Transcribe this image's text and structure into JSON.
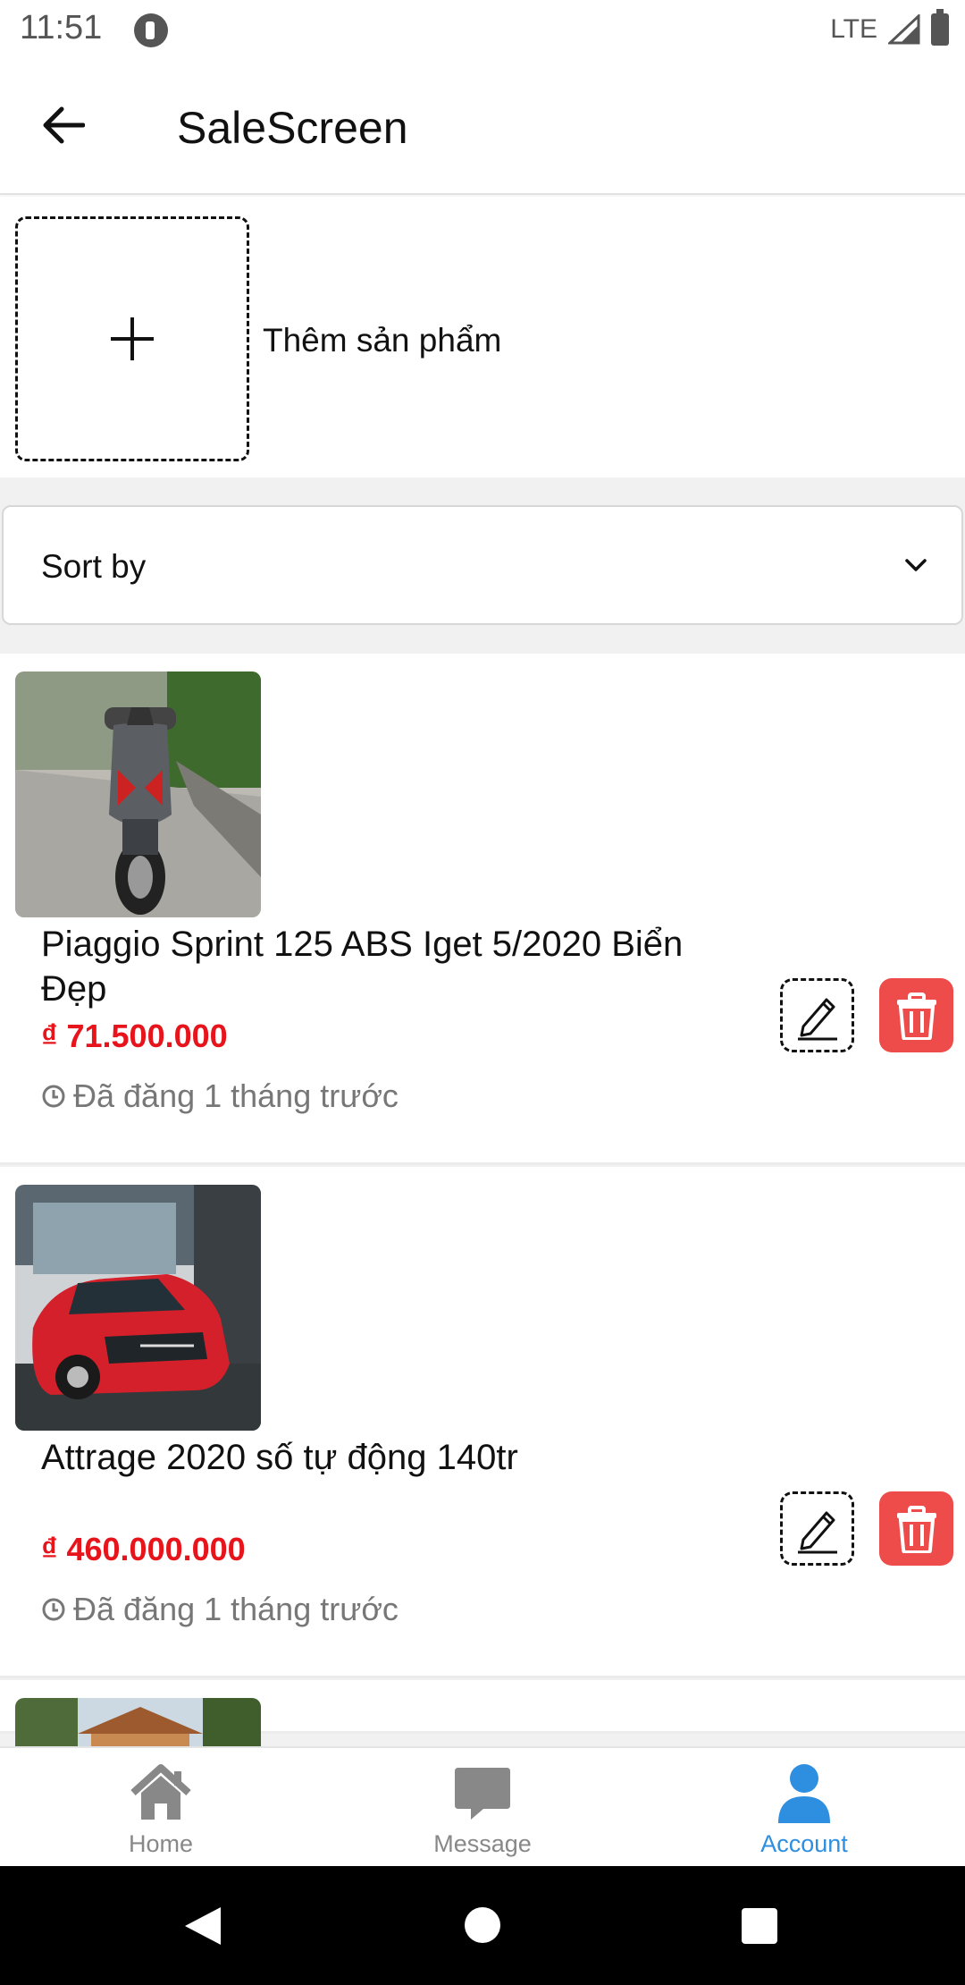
{
  "status_bar": {
    "time": "11:51",
    "network": "LTE",
    "icons": [
      "app-notification-icon",
      "signal-icon",
      "battery-icon"
    ]
  },
  "header": {
    "title": "SaleScreen",
    "back_icon": "arrow-left-icon"
  },
  "add_product": {
    "label": "Thêm sản phẩm",
    "icon": "plus-icon"
  },
  "sort": {
    "label": "Sort by",
    "icon": "chevron-down-icon"
  },
  "products": [
    {
      "title": "Piaggio Sprint 125 ABS Iget 5/2020 Biển Đẹp",
      "price": "₫ 71.500.000",
      "posted": "Đã đăng 1 tháng trước",
      "image": "grey-scooter-photo"
    },
    {
      "title": "Attrage 2020 số tự động 140tr",
      "price": "₫ 460.000.000",
      "posted": "Đã đăng 1 tháng trước",
      "image": "red-car-photo"
    },
    {
      "image": "temple-photo"
    }
  ],
  "bottom_nav": {
    "items": [
      {
        "label": "Home",
        "icon": "home-icon",
        "active": false
      },
      {
        "label": "Message",
        "icon": "message-icon",
        "active": false
      },
      {
        "label": "Account",
        "icon": "account-icon",
        "active": true
      }
    ]
  },
  "colors": {
    "price": "#e8141b",
    "delete": "#ee4b4b",
    "active_nav": "#2e8fe0",
    "inactive_nav": "#888888"
  }
}
